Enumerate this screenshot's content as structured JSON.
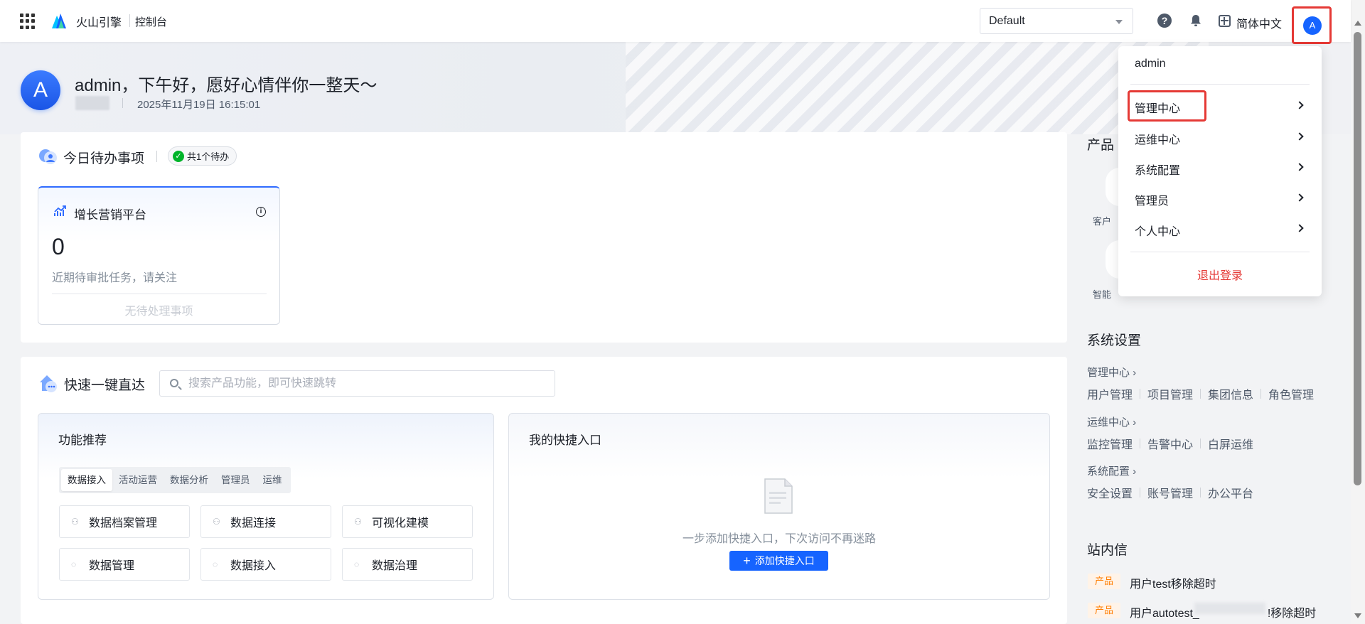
{
  "header": {
    "brand": "火山引擎",
    "console": "控制台",
    "environment": "Default",
    "language": "简体中文",
    "avatar_initial": "A"
  },
  "welcome": {
    "avatar_initial": "A",
    "greeting": "admin，下午好，愿好心情伴你一整天～",
    "datetime": "2025年11月19日 16:15:01"
  },
  "todo": {
    "title": "今日待办事项",
    "badge": "共1个待办",
    "card": {
      "title": "增长营销平台",
      "count": "0",
      "description": "近期待审批任务，请关注",
      "empty": "无待处理事项"
    }
  },
  "quick": {
    "title": "快速一键直达",
    "search_placeholder": "搜索产品功能，即可快速跳转",
    "functions": {
      "title": "功能推荐",
      "tabs": [
        "数据接入",
        "活动运营",
        "数据分析",
        "管理员",
        "运维"
      ],
      "active_tab": "数据接入",
      "items": [
        "数据档案管理",
        "数据连接",
        "可视化建模",
        "数据管理",
        "数据接入",
        "数据治理"
      ]
    },
    "shortcuts": {
      "title": "我的快捷入口",
      "empty_text": "一步添加快捷入口，下次访问不再迷路",
      "add_button": "添加快捷入口"
    }
  },
  "sidebar": {
    "products_title": "产品",
    "products": [
      "客户",
      "智能"
    ],
    "settings_title": "系统设置",
    "groups": [
      {
        "title": "管理中心",
        "links": [
          "用户管理",
          "项目管理",
          "集团信息",
          "角色管理"
        ]
      },
      {
        "title": "运维中心",
        "links": [
          "监控管理",
          "告警中心",
          "白屏运维"
        ]
      },
      {
        "title": "系统配置",
        "links": [
          "安全设置",
          "账号管理",
          "办公平台"
        ]
      }
    ],
    "inbox_title": "站内信",
    "messages": [
      {
        "tag": "产品",
        "text_prefix": "用户test移除超时",
        "text_suffix": ""
      },
      {
        "tag": "产品",
        "text_prefix": "用户autotest_",
        "text_suffix": "!移除超时"
      }
    ]
  },
  "user_menu": {
    "username": "admin",
    "items": [
      "管理中心",
      "运维中心",
      "系统配置",
      "管理员",
      "个人中心"
    ],
    "logout": "退出登录"
  },
  "colors": {
    "primary": "#1664ff",
    "danger": "#e53935",
    "success": "#00b42a",
    "warning": "#ff7d00"
  }
}
